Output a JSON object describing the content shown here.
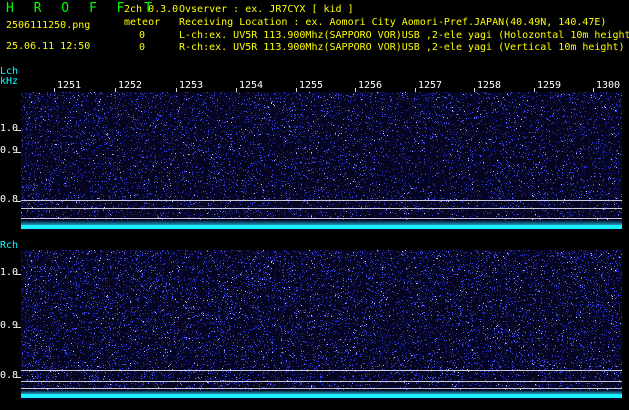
{
  "header": {
    "app_title": "H R O F F T",
    "filename": "2506111250.png",
    "datetime": "25.06.11 12:50",
    "version": "2ch 0.3.0",
    "meteor_label": "meteor",
    "meteor_count_l": "0",
    "meteor_count_r": "0",
    "observer": "Ovserver          : ex. JR7CYX [ kid ]",
    "location": "Receiving Location : ex. Aomori City Aomori-Pref.JAPAN(40.49N, 140.47E)",
    "lch_info": "L-ch:ex. UV5R 113.900Mhz(SAPPORO VOR)USB ,2-ele yagi (Holozontal 10m height)",
    "rch_info": "R-ch:ex. UV5R 113.900Mhz(SAPPORO VOR)USB ,2-ele yagi (Vertical 10m height)"
  },
  "axes": {
    "lch_label": "Lch",
    "rch_label": "Rch",
    "unit": "kHz",
    "x_ticks": [
      "1251",
      "1252",
      "1253",
      "1254",
      "1255",
      "1256",
      "1257",
      "1258",
      "1259",
      "1300"
    ],
    "y_ticks": [
      "1.0",
      "0.9",
      "0.8"
    ]
  },
  "colors": {
    "title_green": "#00ff00",
    "label_yellow": "#ffff00",
    "label_cyan": "#00ffff",
    "axis_white": "#ffffff",
    "signal_cyan": "#1cf2ff",
    "noise_blue": "#3a46ff"
  }
}
